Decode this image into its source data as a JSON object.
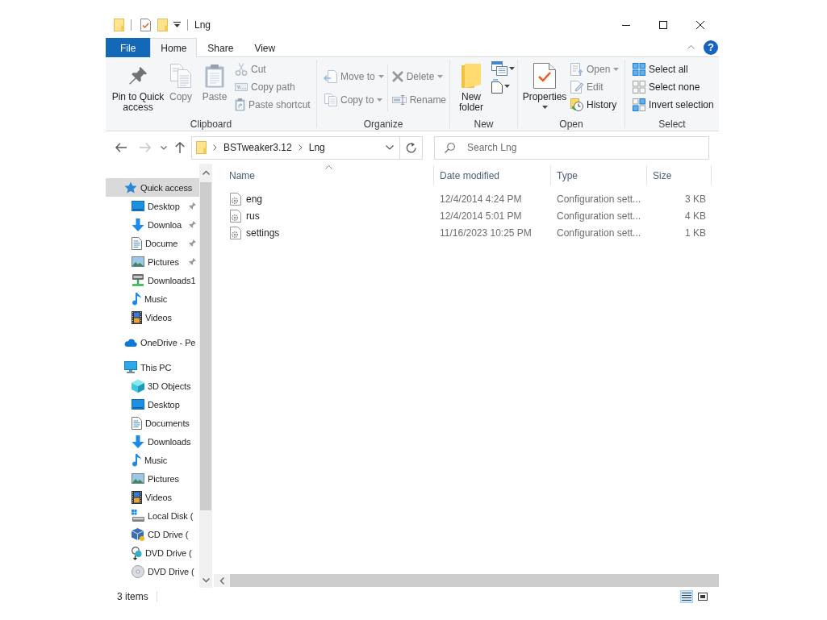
{
  "window": {
    "title": "Lng"
  },
  "ribbon_tabs": [
    {
      "label": "File",
      "kind": "file",
      "selected": false
    },
    {
      "label": "Home",
      "kind": "tab",
      "selected": true
    },
    {
      "label": "Share",
      "kind": "tab",
      "selected": false
    },
    {
      "label": "View",
      "kind": "tab",
      "selected": false
    }
  ],
  "help_button": {
    "label": "?"
  },
  "ribbon": {
    "clipboard": {
      "label": "Clipboard",
      "pin_to_quick_access": {
        "label": "Pin to Quick access",
        "disabled": false
      },
      "copy": {
        "label": "Copy",
        "disabled": true
      },
      "paste": {
        "label": "Paste",
        "disabled": true
      },
      "cut": {
        "label": "Cut",
        "disabled": true
      },
      "copy_path": {
        "label": "Copy path",
        "disabled": true
      },
      "paste_shortcut": {
        "label": "Paste shortcut",
        "disabled": true
      }
    },
    "organize": {
      "label": "Organize",
      "move_to": {
        "label": "Move to",
        "disabled": true
      },
      "copy_to": {
        "label": "Copy to",
        "disabled": true
      },
      "delete": {
        "label": "Delete",
        "disabled": true
      },
      "rename": {
        "label": "Rename",
        "disabled": true
      }
    },
    "new": {
      "label": "New",
      "new_folder": {
        "label": "New folder",
        "disabled": false
      }
    },
    "open": {
      "label": "Open",
      "properties": {
        "label": "Properties",
        "disabled": false
      },
      "open": {
        "label": "Open",
        "disabled": true
      },
      "edit": {
        "label": "Edit",
        "disabled": true
      },
      "history": {
        "label": "History",
        "disabled": false
      }
    },
    "select": {
      "label": "Select",
      "select_all": {
        "label": "Select all",
        "disabled": false
      },
      "select_none": {
        "label": "Select none",
        "disabled": false
      },
      "invert_selection": {
        "label": "Invert selection",
        "disabled": false
      }
    }
  },
  "navigation_buttons": {
    "back": {
      "disabled": false
    },
    "forward": {
      "disabled": true
    }
  },
  "address_bar": {
    "segments": [
      "BSTweaker3.12",
      "Lng"
    ]
  },
  "search": {
    "placeholder": "Search Lng"
  },
  "navigation_pane": {
    "items": [
      {
        "label": "Quick access",
        "kind": "quick_access",
        "selected": true,
        "children": [
          {
            "label": "Desktop",
            "kind": "desktop",
            "pinned": true,
            "selected": false
          },
          {
            "label": "Downloa",
            "kind": "downloads",
            "pinned": true,
            "selected": false
          },
          {
            "label": "Docume",
            "kind": "documents",
            "pinned": true,
            "selected": false
          },
          {
            "label": "Pictures",
            "kind": "pictures",
            "pinned": true,
            "selected": false
          },
          {
            "label": "Downloads1",
            "kind": "network_drive",
            "pinned": false,
            "selected": false
          },
          {
            "label": "Music",
            "kind": "music",
            "pinned": false,
            "selected": false
          },
          {
            "label": "Videos",
            "kind": "videos",
            "pinned": false,
            "selected": false
          }
        ]
      },
      {
        "label": "OneDrive - Pe",
        "kind": "onedrive",
        "selected": false
      },
      {
        "label": "This PC",
        "kind": "pc",
        "selected": false,
        "children": [
          {
            "label": "3D Objects",
            "kind": "objects_3d",
            "selected": false
          },
          {
            "label": "Desktop",
            "kind": "desktop",
            "selected": false
          },
          {
            "label": "Documents",
            "kind": "documents",
            "selected": false
          },
          {
            "label": "Downloads",
            "kind": "downloads",
            "selected": false
          },
          {
            "label": "Music",
            "kind": "music",
            "selected": false
          },
          {
            "label": "Pictures",
            "kind": "pictures",
            "selected": false
          },
          {
            "label": "Videos",
            "kind": "videos",
            "selected": false
          },
          {
            "label": "Local Disk (",
            "kind": "local_disk",
            "selected": false
          },
          {
            "label": "CD Drive (",
            "kind": "cd_drive",
            "selected": false
          },
          {
            "label": "DVD Drive (",
            "kind": "dvd_drive",
            "selected": false
          },
          {
            "label": "DVD Drive (",
            "kind": "disc",
            "selected": false
          }
        ]
      }
    ]
  },
  "file_list": {
    "columns": [
      {
        "label": "Name",
        "sorted": true
      },
      {
        "label": "Date modified",
        "sorted": false
      },
      {
        "label": "Type",
        "sorted": false
      },
      {
        "label": "Size",
        "sorted": false
      }
    ],
    "rows": [
      {
        "name": "eng",
        "date_modified": "12/4/2014 4:24 PM",
        "type": "Configuration sett...",
        "size": "3 KB",
        "selected": false
      },
      {
        "name": "rus",
        "date_modified": "12/4/2014 5:01 PM",
        "type": "Configuration sett...",
        "size": "4 KB",
        "selected": false
      },
      {
        "name": "settings",
        "date_modified": "11/16/2023 10:25 PM",
        "type": "Configuration sett...",
        "size": "1 KB",
        "selected": false
      }
    ]
  },
  "status_bar": {
    "item_count": "3 items",
    "view_buttons": [
      {
        "kind": "details",
        "selected": true
      },
      {
        "kind": "large_icons",
        "selected": false
      }
    ]
  }
}
